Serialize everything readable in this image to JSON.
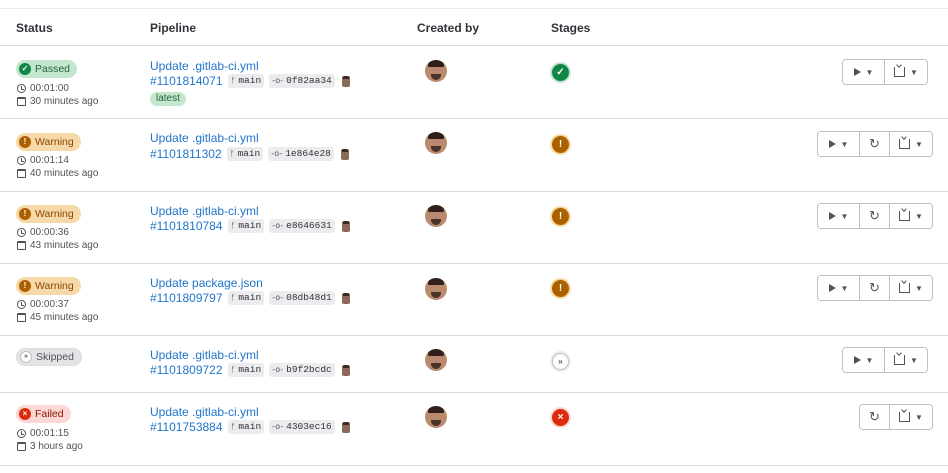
{
  "table": {
    "headers": {
      "status": "Status",
      "pipeline": "Pipeline",
      "created_by": "Created by",
      "stages": "Stages"
    }
  },
  "status_colors": {
    "passed": "#108548",
    "warning": "#ab6100",
    "skipped": "#535158",
    "failed": "#dd2b0e",
    "link": "#1f75cb"
  },
  "pipelines": [
    {
      "status": "Passed",
      "status_icon": "check-circle-icon",
      "duration": "00:01:00",
      "finished": "30 minutes ago",
      "title": "Update .gitlab-ci.yml",
      "id": "#1101814071",
      "branch": "main",
      "commit": "0f82aa34",
      "tag": "latest",
      "stage_icon": "check",
      "actions": [
        "play",
        "download"
      ]
    },
    {
      "status": "Warning",
      "status_icon": "warning-icon",
      "duration": "00:01:14",
      "finished": "40 minutes ago",
      "title": "Update .gitlab-ci.yml",
      "id": "#1101811302",
      "branch": "main",
      "commit": "1e864e28",
      "stage_icon": "warning",
      "actions": [
        "play",
        "retry",
        "download"
      ]
    },
    {
      "status": "Warning",
      "status_icon": "warning-icon",
      "duration": "00:00:36",
      "finished": "43 minutes ago",
      "title": "Update .gitlab-ci.yml",
      "id": "#1101810784",
      "branch": "main",
      "commit": "e8646631",
      "stage_icon": "warning",
      "actions": [
        "play",
        "retry",
        "download"
      ]
    },
    {
      "status": "Warning",
      "status_icon": "warning-icon",
      "duration": "00:00:37",
      "finished": "45 minutes ago",
      "title": "Update package.json",
      "id": "#1101809797",
      "branch": "main",
      "commit": "08db48d1",
      "stage_icon": "warning",
      "actions": [
        "play",
        "retry",
        "download"
      ]
    },
    {
      "status": "Skipped",
      "status_icon": "skipped-icon",
      "title": "Update .gitlab-ci.yml",
      "id": "#1101809722",
      "branch": "main",
      "commit": "b9f2bcdc",
      "stage_icon": "skipped",
      "actions": [
        "play",
        "download"
      ]
    },
    {
      "status": "Failed",
      "status_icon": "failed-icon",
      "duration": "00:01:15",
      "finished": "3 hours ago",
      "title": "Update .gitlab-ci.yml",
      "id": "#1101753884",
      "branch": "main",
      "commit": "4303ec16",
      "stage_icon": "failed",
      "actions": [
        "retry",
        "download"
      ]
    }
  ]
}
